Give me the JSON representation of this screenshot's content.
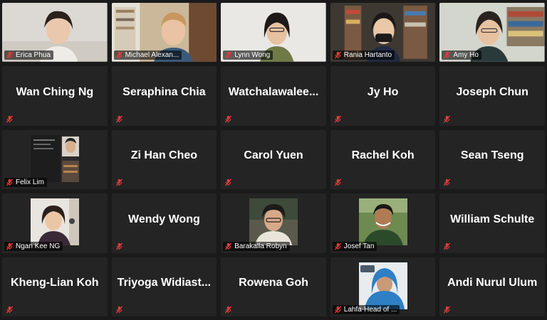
{
  "participants": [
    {
      "name": "Erica Phua",
      "display": "video",
      "bg": "#d9d6d1"
    },
    {
      "name": "Michael Alexan...",
      "display": "video",
      "bg": "#b9a98e"
    },
    {
      "name": "Lynn Wong",
      "display": "video",
      "bg": "#e7e6e2"
    },
    {
      "name": "Rania Hartanto",
      "display": "video",
      "bg": "#3f3a34"
    },
    {
      "name": "Amy Ho",
      "display": "video",
      "bg": "#cfd2c8"
    },
    {
      "name": "Wan Ching Ng",
      "display": "name"
    },
    {
      "name": "Seraphina Chia",
      "display": "name"
    },
    {
      "name": "Watchalawalee...",
      "display": "name"
    },
    {
      "name": "Jy Ho",
      "display": "name"
    },
    {
      "name": "Joseph Chun",
      "display": "name"
    },
    {
      "name": "Felix Lim",
      "display": "thumb"
    },
    {
      "name": "Zi Han Cheo",
      "display": "name"
    },
    {
      "name": "Carol Yuen",
      "display": "name"
    },
    {
      "name": "Rachel Koh",
      "display": "name"
    },
    {
      "name": "Sean Tseng",
      "display": "name"
    },
    {
      "name": "Ngan Kee NG",
      "display": "thumb"
    },
    {
      "name": "Wendy Wong",
      "display": "name"
    },
    {
      "name": "Barakalla Robyn",
      "display": "thumb"
    },
    {
      "name": "Josef Tan",
      "display": "thumb"
    },
    {
      "name": "William Schulte",
      "display": "name"
    },
    {
      "name": "Kheng-Lian Koh",
      "display": "name"
    },
    {
      "name": "Triyoga  Widiast...",
      "display": "name"
    },
    {
      "name": "Rowena Goh",
      "display": "name"
    },
    {
      "name": "Lahfa-Head of ...",
      "display": "thumb"
    },
    {
      "name": "Andi Nurul Ulum",
      "display": "name"
    }
  ],
  "colors": {
    "background": "#1a1a1a",
    "tile": "#242424",
    "muted_icon": "#e23a3a",
    "text": "#ffffff"
  },
  "icons": {
    "mic": "microphone-muted-icon"
  }
}
